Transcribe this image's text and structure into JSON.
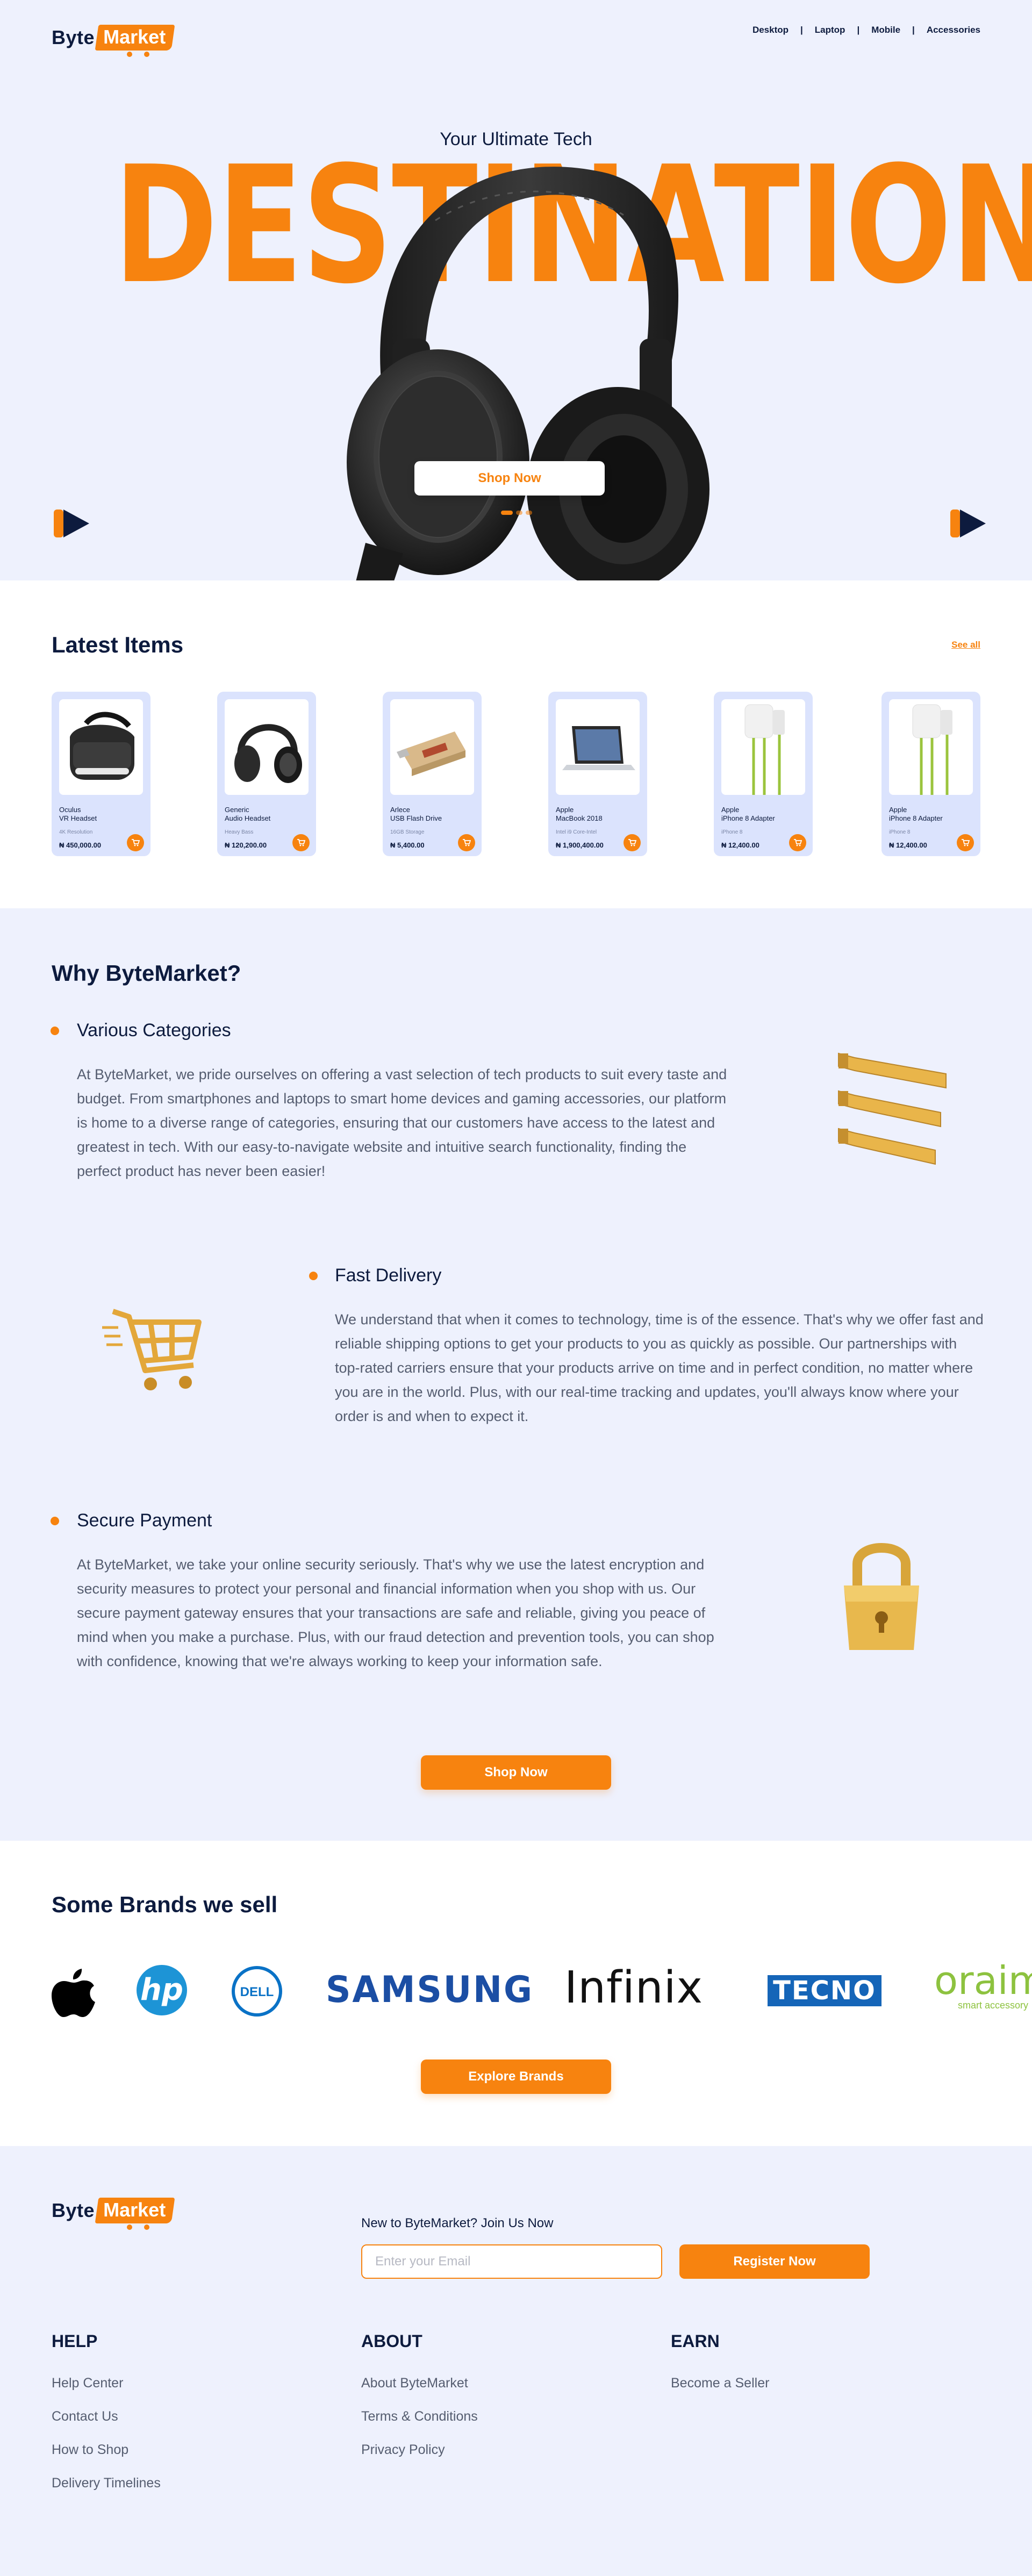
{
  "logo": {
    "byte": "Byte",
    "market": "Market"
  },
  "nav": {
    "items": [
      "Desktop",
      "Laptop",
      "Mobile",
      "Accessories"
    ]
  },
  "hero": {
    "subtitle": "Your Ultimate Tech",
    "title": "DESTINATION",
    "cta": "Shop Now",
    "slides_total": 3,
    "slide_active": 1
  },
  "latest": {
    "title": "Latest Items",
    "see_all": "See all",
    "items": [
      {
        "brand": "Oculus",
        "name": "VR Headset",
        "spec": "4K Resolution",
        "price": "₦ 450,000.00",
        "icon": "vr-headset-image"
      },
      {
        "brand": "Generic",
        "name": "Audio Headset",
        "spec": "Heavy Bass",
        "price": "₦ 120,200.00",
        "icon": "headphones-image"
      },
      {
        "brand": "Arlece",
        "name": "USB Flash Drive",
        "spec": "16GB Storage",
        "price": "₦ 5,400.00",
        "icon": "flash-drive-image"
      },
      {
        "brand": "Apple",
        "name": "MacBook 2018",
        "spec": "Intel i9 Core-Intel",
        "price": "₦ 1,900,400.00",
        "icon": "laptop-image"
      },
      {
        "brand": "Apple",
        "name": "iPhone 8 Adapter",
        "spec": "iPhone 8",
        "price": "₦ 12,400.00",
        "icon": "charger-image"
      },
      {
        "brand": "Apple",
        "name": "iPhone 8 Adapter",
        "spec": "iPhone 8",
        "price": "₦ 12,400.00",
        "icon": "charger-image"
      }
    ]
  },
  "why": {
    "title": "Why ByteMarket?",
    "features": [
      {
        "title": "Various Categories",
        "text": "At ByteMarket, we pride ourselves on offering a vast selection of tech products to suit every taste and budget. From smartphones and laptops to smart home devices and gaming accessories, our platform is home to a diverse range of categories, ensuring that our customers have access to the latest and greatest in tech. With our easy-to-navigate website and intuitive search functionality, finding the perfect product has never been easier!",
        "icon": "categories-icon"
      },
      {
        "title": "Fast Delivery",
        "text": "We understand that when it comes to technology, time is of the essence. That's why we offer fast and reliable shipping options to get your products to you as quickly as possible. Our partnerships with top-rated carriers ensure that your products arrive on time and in perfect condition, no matter where you are in the world. Plus, with our real-time tracking and updates, you'll always know where your order is and when to expect it.",
        "icon": "cart-icon"
      },
      {
        "title": "Secure Payment",
        "text": "At ByteMarket, we take your online security seriously. That's why we use the latest encryption and security measures to protect your personal and financial information when you shop with us. Our secure payment gateway ensures that your transactions are safe and reliable, giving you peace of mind when you make a purchase. Plus, with our fraud detection and prevention tools, you can shop with confidence, knowing that we're always working to keep your information safe.",
        "icon": "padlock-icon"
      }
    ],
    "cta": "Shop Now"
  },
  "brands": {
    "title": "Some Brands we sell",
    "list": [
      {
        "name": "apple",
        "icon": "apple-logo"
      },
      {
        "name": "hp",
        "icon": "hp-logo"
      },
      {
        "name": "DELL",
        "icon": "dell-logo"
      },
      {
        "name": "SAMSUNG",
        "icon": "samsung-logo"
      },
      {
        "name": "Infinix",
        "icon": "infinix-logo"
      },
      {
        "name": "TECNO",
        "icon": "tecno-logo"
      },
      {
        "name": "oraimo",
        "tagline": "smart accessory",
        "icon": "oraimo-logo"
      }
    ],
    "cta": "Explore Brands"
  },
  "footer": {
    "join_text": "New to ByteMarket? Join Us Now",
    "email_placeholder": "Enter your Email",
    "register": "Register Now",
    "columns": [
      {
        "title": "HELP",
        "links": [
          "Help Center",
          "Contact Us",
          "How to Shop",
          "Delivery Timelines"
        ]
      },
      {
        "title": "ABOUT",
        "links": [
          "About ByteMarket",
          "Terms & Conditions",
          "Privacy Policy"
        ]
      },
      {
        "title": "EARN",
        "links": [
          "Become a Seller"
        ]
      }
    ]
  },
  "colors": {
    "accent": "#f7830f",
    "navy": "#0d1b3e",
    "bg": "#eef1fd",
    "card": "#dbe3fd"
  }
}
